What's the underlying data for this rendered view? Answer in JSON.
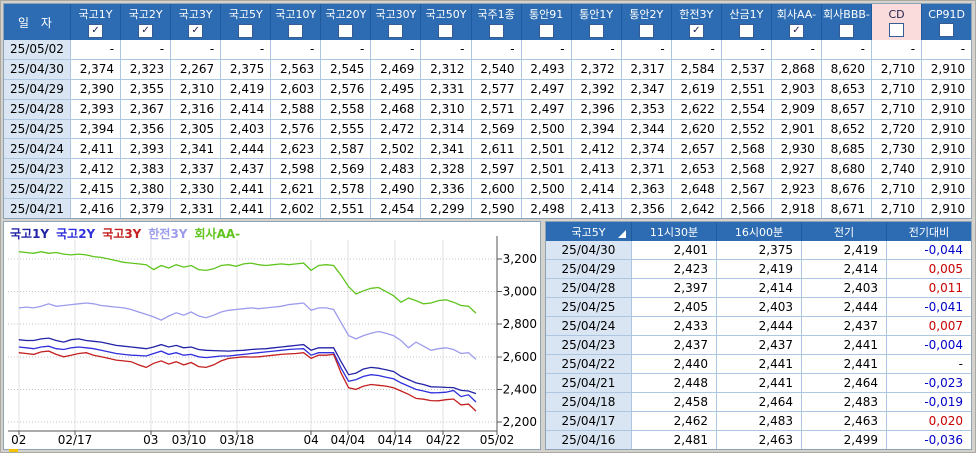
{
  "colors": {
    "header_bg": "#2D6CB2",
    "date_cell_bg": "#D9E5F2",
    "highlight_column_bg": "#FBDCDC",
    "grid_border": "#ADC6E2",
    "negative_change": "#0000C8",
    "positive_change": "#C80000"
  },
  "icons": {
    "check_glyph": "✓",
    "sort_indicator": "corner-triangle"
  },
  "top_table": {
    "date_header": "일  자",
    "columns": [
      {
        "label": "국고1Y",
        "checked": true,
        "highlight": false
      },
      {
        "label": "국고2Y",
        "checked": true,
        "highlight": false
      },
      {
        "label": "국고3Y",
        "checked": true,
        "highlight": false
      },
      {
        "label": "국고5Y",
        "checked": false,
        "highlight": false
      },
      {
        "label": "국고10Y",
        "checked": false,
        "highlight": false
      },
      {
        "label": "국고20Y",
        "checked": false,
        "highlight": false
      },
      {
        "label": "국고30Y",
        "checked": false,
        "highlight": false
      },
      {
        "label": "국고50Y",
        "checked": false,
        "highlight": false
      },
      {
        "label": "국주1종",
        "checked": false,
        "highlight": false
      },
      {
        "label": "통안91",
        "checked": false,
        "highlight": false
      },
      {
        "label": "통안1Y",
        "checked": false,
        "highlight": false
      },
      {
        "label": "통안2Y",
        "checked": false,
        "highlight": false
      },
      {
        "label": "한전3Y",
        "checked": true,
        "highlight": false
      },
      {
        "label": "산금1Y",
        "checked": false,
        "highlight": false
      },
      {
        "label": "회사AA-",
        "checked": true,
        "highlight": false
      },
      {
        "label": "회사BBB-",
        "checked": false,
        "highlight": false
      },
      {
        "label": "CD",
        "checked": false,
        "highlight": true
      },
      {
        "label": "CP91D",
        "checked": false,
        "highlight": false
      }
    ],
    "rows": [
      {
        "date": "25/05/02",
        "values": [
          "-",
          "-",
          "-",
          "-",
          "-",
          "-",
          "-",
          "-",
          "-",
          "-",
          "-",
          "-",
          "-",
          "-",
          "-",
          "-",
          "-",
          "-"
        ]
      },
      {
        "date": "25/04/30",
        "values": [
          "2,374",
          "2,323",
          "2,267",
          "2,375",
          "2,563",
          "2,545",
          "2,469",
          "2,312",
          "2,540",
          "2,493",
          "2,372",
          "2,317",
          "2,584",
          "2,537",
          "2,868",
          "8,620",
          "2,710",
          "2,910"
        ]
      },
      {
        "date": "25/04/29",
        "values": [
          "2,390",
          "2,355",
          "2,310",
          "2,419",
          "2,603",
          "2,576",
          "2,495",
          "2,331",
          "2,577",
          "2,497",
          "2,392",
          "2,347",
          "2,619",
          "2,551",
          "2,903",
          "8,653",
          "2,710",
          "2,910"
        ]
      },
      {
        "date": "25/04/28",
        "values": [
          "2,393",
          "2,367",
          "2,316",
          "2,414",
          "2,588",
          "2,558",
          "2,468",
          "2,310",
          "2,571",
          "2,497",
          "2,396",
          "2,353",
          "2,622",
          "2,554",
          "2,909",
          "8,657",
          "2,710",
          "2,910"
        ]
      },
      {
        "date": "25/04/25",
        "values": [
          "2,394",
          "2,356",
          "2,305",
          "2,403",
          "2,576",
          "2,555",
          "2,472",
          "2,314",
          "2,569",
          "2,500",
          "2,394",
          "2,344",
          "2,620",
          "2,552",
          "2,901",
          "8,652",
          "2,720",
          "2,910"
        ]
      },
      {
        "date": "25/04/24",
        "values": [
          "2,411",
          "2,393",
          "2,341",
          "2,444",
          "2,623",
          "2,587",
          "2,502",
          "2,341",
          "2,611",
          "2,501",
          "2,412",
          "2,374",
          "2,657",
          "2,568",
          "2,930",
          "8,685",
          "2,730",
          "2,910"
        ]
      },
      {
        "date": "25/04/23",
        "values": [
          "2,412",
          "2,383",
          "2,337",
          "2,437",
          "2,598",
          "2,569",
          "2,483",
          "2,328",
          "2,597",
          "2,501",
          "2,413",
          "2,371",
          "2,653",
          "2,568",
          "2,927",
          "8,680",
          "2,740",
          "2,910"
        ]
      },
      {
        "date": "25/04/22",
        "values": [
          "2,415",
          "2,380",
          "2,330",
          "2,441",
          "2,621",
          "2,578",
          "2,490",
          "2,336",
          "2,600",
          "2,500",
          "2,414",
          "2,363",
          "2,648",
          "2,567",
          "2,923",
          "8,676",
          "2,710",
          "2,910"
        ]
      },
      {
        "date": "25/04/21",
        "values": [
          "2,416",
          "2,379",
          "2,331",
          "2,441",
          "2,602",
          "2,551",
          "2,454",
          "2,299",
          "2,590",
          "2,498",
          "2,413",
          "2,356",
          "2,642",
          "2,566",
          "2,918",
          "8,671",
          "2,710",
          "2,910"
        ]
      }
    ]
  },
  "chart": {
    "y_ticks": [
      "3,200",
      "3,000",
      "2,800",
      "2,600",
      "2,400",
      "2,200"
    ],
    "x_ticks": [
      {
        "label": "02",
        "pos": 0.022
      },
      {
        "label": "02/17",
        "pos": 0.137
      },
      {
        "label": "03",
        "pos": 0.292
      },
      {
        "label": "03/10",
        "pos": 0.37
      },
      {
        "label": "03/18",
        "pos": 0.468
      },
      {
        "label": "04",
        "pos": 0.62
      },
      {
        "label": "04/04",
        "pos": 0.695
      },
      {
        "label": "04/14",
        "pos": 0.791
      },
      {
        "label": "04/22",
        "pos": 0.89
      },
      {
        "label": "05/02",
        "pos": 1.0
      }
    ]
  },
  "chart_data": {
    "type": "line",
    "title": "",
    "y_axis": {
      "min": 2200,
      "max": 3200,
      "tick_step": 200,
      "unit": "yield x1000 (2374 = 2.374%)",
      "side": "right",
      "grid": "dotted"
    },
    "x_axis": {
      "range": "2025-02-03 to 2025-05-02",
      "tick_labels": [
        "02",
        "02/17",
        "03",
        "03/10",
        "03/18",
        "04",
        "04/04",
        "04/14",
        "04/22",
        "05/02"
      ]
    },
    "legend_position": "top-left",
    "series": [
      {
        "name": "국고1Y",
        "color": "#2323A8",
        "values": [
          2705,
          2700,
          2700,
          2710,
          2715,
          2700,
          2690,
          2705,
          2710,
          2700,
          2695,
          2690,
          2680,
          2670,
          2665,
          2660,
          2655,
          2650,
          2660,
          2675,
          2660,
          2670,
          2655,
          2660,
          2645,
          2640,
          2638,
          2636,
          2635,
          2638,
          2640,
          2645,
          2648,
          2650,
          2655,
          2660,
          2665,
          2670,
          2675,
          2640,
          2655,
          2655,
          2655,
          2570,
          2490,
          2500,
          2525,
          2535,
          2530,
          2520,
          2510,
          2480,
          2460,
          2440,
          2430,
          2416,
          2415,
          2412,
          2411,
          2394,
          2390,
          2374
        ]
      },
      {
        "name": "국고2Y",
        "color": "#3030DC",
        "values": [
          2660,
          2655,
          2650,
          2660,
          2665,
          2650,
          2645,
          2655,
          2660,
          2655,
          2650,
          2640,
          2630,
          2620,
          2615,
          2610,
          2608,
          2605,
          2620,
          2635,
          2615,
          2625,
          2610,
          2615,
          2600,
          2595,
          2600,
          2605,
          2605,
          2610,
          2615,
          2620,
          2625,
          2630,
          2635,
          2640,
          2645,
          2648,
          2650,
          2610,
          2625,
          2625,
          2625,
          2530,
          2450,
          2460,
          2480,
          2490,
          2485,
          2475,
          2465,
          2440,
          2420,
          2400,
          2390,
          2379,
          2380,
          2383,
          2393,
          2356,
          2367,
          2323
        ]
      },
      {
        "name": "국고3Y",
        "color": "#C42020",
        "values": [
          2625,
          2620,
          2615,
          2630,
          2635,
          2615,
          2600,
          2610,
          2620,
          2625,
          2610,
          2600,
          2590,
          2580,
          2575,
          2570,
          2550,
          2535,
          2560,
          2575,
          2555,
          2570,
          2550,
          2565,
          2540,
          2535,
          2550,
          2575,
          2590,
          2595,
          2600,
          2598,
          2600,
          2605,
          2610,
          2615,
          2618,
          2620,
          2625,
          2590,
          2610,
          2610,
          2615,
          2500,
          2410,
          2400,
          2420,
          2430,
          2425,
          2420,
          2410,
          2390,
          2370,
          2345,
          2340,
          2331,
          2330,
          2337,
          2341,
          2305,
          2310,
          2267
        ]
      },
      {
        "name": "한전3Y",
        "color": "#9C9CEC",
        "values": [
          2900,
          2905,
          2900,
          2910,
          2925,
          2910,
          2915,
          2920,
          2925,
          2930,
          2925,
          2915,
          2910,
          2905,
          2900,
          2890,
          2875,
          2860,
          2845,
          2825,
          2850,
          2870,
          2855,
          2875,
          2850,
          2840,
          2855,
          2875,
          2885,
          2890,
          2895,
          2900,
          2895,
          2900,
          2905,
          2910,
          2920,
          2925,
          2930,
          2885,
          2900,
          2900,
          2890,
          2810,
          2730,
          2710,
          2730,
          2745,
          2755,
          2745,
          2730,
          2700,
          2655,
          2690,
          2665,
          2640,
          2650,
          2655,
          2645,
          2620,
          2625,
          2584
        ]
      },
      {
        "name": "회사AA-",
        "color": "#5FC41E",
        "values": [
          3245,
          3240,
          3235,
          3245,
          3235,
          3240,
          3230,
          3225,
          3230,
          3225,
          3215,
          3210,
          3200,
          3190,
          3180,
          3175,
          3170,
          3165,
          3135,
          3160,
          3145,
          3165,
          3150,
          3160,
          3135,
          3130,
          3140,
          3160,
          3165,
          3155,
          3170,
          3175,
          3165,
          3160,
          3165,
          3170,
          3165,
          3170,
          3175,
          3130,
          3160,
          3165,
          3160,
          3100,
          3030,
          2985,
          3005,
          3020,
          3025,
          3000,
          2975,
          2935,
          2960,
          2945,
          2925,
          2930,
          2945,
          2950,
          2935,
          2915,
          2910,
          2868
        ]
      }
    ]
  },
  "detail_table": {
    "headers": [
      "국고5Y",
      "11시30분",
      "16시00분",
      "전기",
      "전기대비"
    ],
    "rows": [
      {
        "date": "25/04/30",
        "cells": [
          "2,401",
          "2,375",
          "2,419"
        ],
        "change": "-0,044",
        "change_sign": "neg"
      },
      {
        "date": "25/04/29",
        "cells": [
          "2,423",
          "2,419",
          "2,414"
        ],
        "change": "0,005",
        "change_sign": "pos"
      },
      {
        "date": "25/04/28",
        "cells": [
          "2,397",
          "2,414",
          "2,403"
        ],
        "change": "0,011",
        "change_sign": "pos"
      },
      {
        "date": "25/04/25",
        "cells": [
          "2,405",
          "2,403",
          "2,444"
        ],
        "change": "-0,041",
        "change_sign": "neg"
      },
      {
        "date": "25/04/24",
        "cells": [
          "2,433",
          "2,444",
          "2,437"
        ],
        "change": "0,007",
        "change_sign": "pos"
      },
      {
        "date": "25/04/23",
        "cells": [
          "2,437",
          "2,437",
          "2,441"
        ],
        "change": "-0,004",
        "change_sign": "neg"
      },
      {
        "date": "25/04/22",
        "cells": [
          "2,440",
          "2,441",
          "2,441"
        ],
        "change": "-",
        "change_sign": "flat"
      },
      {
        "date": "25/04/21",
        "cells": [
          "2,448",
          "2,441",
          "2,464"
        ],
        "change": "-0,023",
        "change_sign": "neg"
      },
      {
        "date": "25/04/18",
        "cells": [
          "2,458",
          "2,464",
          "2,483"
        ],
        "change": "-0,019",
        "change_sign": "neg"
      },
      {
        "date": "25/04/17",
        "cells": [
          "2,462",
          "2,483",
          "2,463"
        ],
        "change": "0,020",
        "change_sign": "pos"
      },
      {
        "date": "25/04/16",
        "cells": [
          "2,481",
          "2,463",
          "2,499"
        ],
        "change": "-0,036",
        "change_sign": "neg"
      }
    ]
  }
}
